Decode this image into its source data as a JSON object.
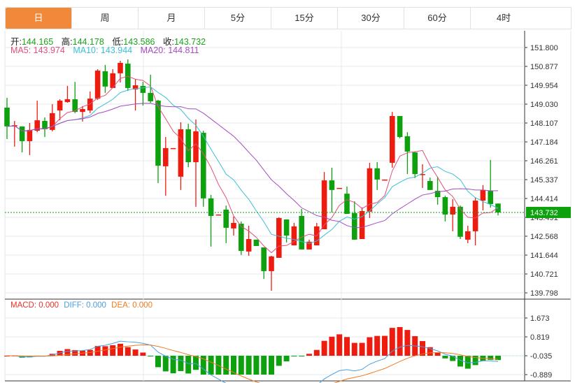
{
  "tabs": [
    "日",
    "周",
    "月",
    "5分",
    "15分",
    "30分",
    "60分",
    "4时"
  ],
  "active_tab": 0,
  "ohlc_legend": {
    "open_label": "开:",
    "open": "144.165",
    "high_label": "高:",
    "high": "144.178",
    "low_label": "低:",
    "low": "143.586",
    "close_label": "收:",
    "close": "143.732"
  },
  "ma_legend": {
    "ma5": "MA5: 143.974",
    "ma10": "MA10: 143.944",
    "ma20": "MA20: 144.811"
  },
  "macd_legend": {
    "macd": "MACD: 0.000",
    "diff": "DIFF: 0.000",
    "dea": "DEA: 0.000"
  },
  "price_axis": [
    "151.800",
    "150.877",
    "149.954",
    "149.030",
    "148.107",
    "147.184",
    "146.261",
    "145.337",
    "144.414",
    "143.491",
    "142.568",
    "141.644",
    "140.721",
    "139.798"
  ],
  "price_range": [
    139.798,
    151.8
  ],
  "last_price": "143.732",
  "macd_axis": [
    "1.673",
    "0.819",
    "-0.035",
    "-0.889"
  ],
  "macd_range": [
    -0.889,
    1.673
  ],
  "colors": {
    "up": "#ee1c0e",
    "down": "#0da20d",
    "ma5": "#e0507a",
    "ma10": "#3cbfd6",
    "ma20": "#a44cc0",
    "diff": "#4a9ee0",
    "dea": "#f07a20",
    "accent": "#f0893a"
  },
  "candles": [
    [
      148.86,
      149.34,
      147.32,
      147.94
    ],
    [
      147.94,
      148.21,
      146.95,
      148.0
    ],
    [
      147.94,
      147.94,
      146.67,
      147.22
    ],
    [
      147.22,
      148.11,
      146.54,
      147.77
    ],
    [
      147.73,
      149.2,
      147.66,
      148.24
    ],
    [
      148.21,
      148.38,
      147.42,
      147.8
    ],
    [
      147.77,
      149.03,
      147.7,
      148.59
    ],
    [
      148.72,
      149.27,
      148.24,
      149.2
    ],
    [
      149.13,
      149.92,
      149.1,
      149.27
    ],
    [
      149.27,
      150.12,
      148.59,
      148.65
    ],
    [
      148.65,
      148.93,
      148.18,
      148.79
    ],
    [
      148.72,
      149.65,
      148.59,
      149.3
    ],
    [
      149.3,
      150.74,
      149.24,
      150.67
    ],
    [
      150.64,
      150.95,
      149.58,
      149.89
    ],
    [
      149.82,
      150.74,
      149.82,
      150.54
    ],
    [
      150.54,
      151.15,
      150.09,
      151.05
    ],
    [
      151.01,
      151.22,
      149.68,
      149.82
    ],
    [
      149.75,
      150.26,
      148.72,
      149.95
    ],
    [
      149.92,
      150.12,
      148.96,
      149.58
    ],
    [
      149.58,
      150.47,
      149.1,
      149.17
    ],
    [
      149.2,
      149.24,
      145.17,
      146.02
    ],
    [
      145.99,
      147.42,
      144.55,
      146.88
    ],
    [
      146.84,
      146.88,
      146.84,
      146.88
    ],
    [
      145.48,
      148.14,
      144.83,
      147.8
    ],
    [
      147.8,
      148.07,
      145.95,
      146.19
    ],
    [
      146.19,
      148.28,
      144.01,
      147.7
    ],
    [
      147.63,
      147.73,
      144.01,
      144.42
    ],
    [
      144.42,
      144.59,
      142.06,
      143.56
    ],
    [
      143.59,
      143.63,
      143.59,
      143.63
    ],
    [
      143.87,
      144.07,
      142.23,
      142.98
    ],
    [
      142.95,
      143.53,
      142.6,
      143.22
    ],
    [
      143.18,
      143.29,
      141.65,
      141.85
    ],
    [
      141.82,
      143.08,
      141.61,
      142.43
    ],
    [
      142.4,
      142.4,
      142.09,
      142.09
    ],
    [
      142.02,
      142.02,
      140.48,
      140.86
    ],
    [
      140.86,
      141.61,
      139.9,
      141.58
    ],
    [
      141.51,
      143.49,
      141.51,
      143.46
    ],
    [
      143.39,
      143.39,
      142.26,
      142.6
    ],
    [
      142.12,
      143.22,
      142.12,
      143.05
    ],
    [
      143.56,
      143.9,
      141.92,
      141.92
    ],
    [
      141.92,
      142.4,
      141.92,
      142.3
    ],
    [
      142.12,
      143.22,
      142.12,
      143.05
    ],
    [
      142.91,
      145.71,
      142.91,
      145.3
    ],
    [
      145.3,
      145.92,
      143.73,
      144.83
    ],
    [
      144.89,
      144.93,
      144.89,
      144.93
    ],
    [
      144.65,
      145.0,
      143.66,
      143.66
    ],
    [
      143.7,
      144.28,
      142.4,
      142.4
    ],
    [
      142.43,
      143.97,
      142.43,
      143.8
    ],
    [
      143.77,
      146.16,
      143.46,
      145.89
    ],
    [
      145.89,
      146.19,
      144.83,
      145.34
    ],
    [
      145.34,
      145.34,
      145.34,
      145.34
    ],
    [
      146.16,
      148.65,
      145.92,
      148.45
    ],
    [
      148.45,
      148.45,
      147.36,
      147.42
    ],
    [
      147.46,
      147.66,
      145.61,
      146.71
    ],
    [
      146.67,
      146.71,
      145.41,
      145.61
    ],
    [
      145.61,
      146.09,
      144.93,
      145.61
    ],
    [
      145.27,
      145.44,
      144.83,
      144.83
    ],
    [
      144.79,
      145.48,
      144.11,
      144.48
    ],
    [
      144.48,
      144.55,
      143.29,
      143.63
    ],
    [
      143.63,
      144.38,
      142.81,
      144.01
    ],
    [
      144.01,
      144.07,
      142.43,
      142.54
    ],
    [
      142.4,
      143.08,
      142.23,
      142.81
    ],
    [
      142.81,
      144.45,
      142.12,
      144.31
    ],
    [
      144.31,
      145.07,
      143.83,
      144.83
    ],
    [
      144.79,
      146.3,
      143.97,
      144.14
    ],
    [
      144.165,
      144.178,
      143.586,
      143.732
    ]
  ]
}
